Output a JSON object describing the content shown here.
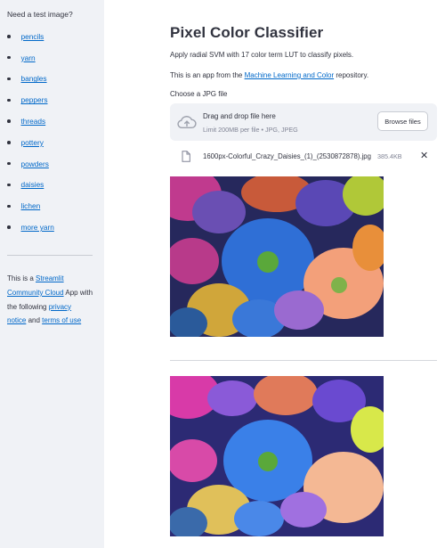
{
  "sidebar": {
    "heading": "Need a test image?",
    "items": [
      "pencils",
      "yarn",
      "bangles",
      "peppers",
      "threads",
      "pottery",
      "powders",
      "daisies",
      "lichen",
      "more yarn"
    ],
    "footer": {
      "t1": "This is a ",
      "streamlit": "Streamlit",
      "community": "Community Cloud",
      "t2": " App with the following ",
      "privacy": "privacy",
      "notice": "notice",
      "t3": " and ",
      "terms": "terms of use"
    }
  },
  "main": {
    "title": "Pixel Color Classifier",
    "description": "Apply radial SVM with 17 color term LUT to classify pixels.",
    "app_from_prefix": "This is an app from the ",
    "repo_link": "Machine Learning and Color",
    "app_from_suffix": " repository.",
    "upload_label": "Choose a JPG file",
    "dropzone_title": "Drag and drop file here",
    "dropzone_sub": "Limit 200MB per file • JPG, JPEG",
    "browse_label": "Browse files",
    "file_name": "1600px-Colorful_Crazy_Daisies_(1)_(2530872878).jpg",
    "file_size": "385.4KB",
    "close_glyph": "✕"
  },
  "icons": [
    "cloud-upload-icon",
    "file-icon",
    "close-icon"
  ],
  "colors": {
    "link": "#0068c9",
    "sidebar_bg": "#f0f2f6",
    "text": "#31333f",
    "muted": "#808495"
  }
}
